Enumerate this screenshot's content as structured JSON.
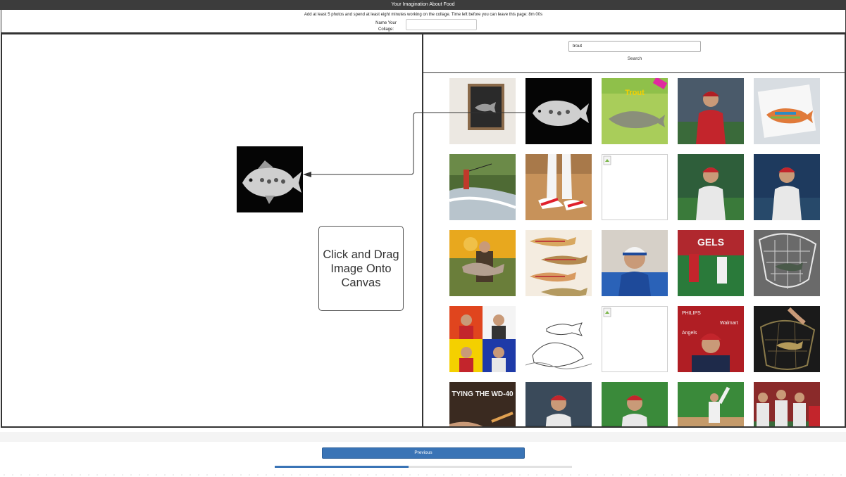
{
  "page": {
    "title": "Your Imagination About Food",
    "instructions": "Add at least 5 photos and spend at least eight minutes working on the collage. Time left before you can leave this page: 8m 00s",
    "name_label": "Name Your Collage:",
    "name_value": ""
  },
  "canvas": {
    "hint": "Click and Drag Image Onto Canvas",
    "placed_image": "black-and-white trout"
  },
  "search": {
    "query": "trout",
    "button_label": "Search"
  },
  "results": [
    "framed fish artwork on wall",
    "black-and-white trout",
    "Trout book cover",
    "Angels baseball player red jersey",
    "colorful trout drawing on paper",
    "fly fisherman in river",
    "baseball cleats on dirt",
    "broken image",
    "Angels player number 27 celebrating",
    "Angels player number 27 pitching",
    "man holding large trout autumn",
    "trout pattern illustration",
    "man in blue baseball cap",
    "Angels players on field",
    "fish in landing net",
    "four-panel collage of people",
    "trout coloring page sketch",
    "broken image",
    "Angels player at press conference",
    "hand holding trout in net",
    "Tying the WD-40 fly",
    "Angels player portrait",
    "Angels player on grass",
    "Angels player waving",
    "Angels players high five"
  ],
  "colors": {
    "accent": "#3a74b6",
    "title_bar": "#3c3c3c",
    "border": "#333333"
  },
  "progress": {
    "fraction": 0.45
  },
  "footer": {
    "previous_label": "Previous"
  }
}
